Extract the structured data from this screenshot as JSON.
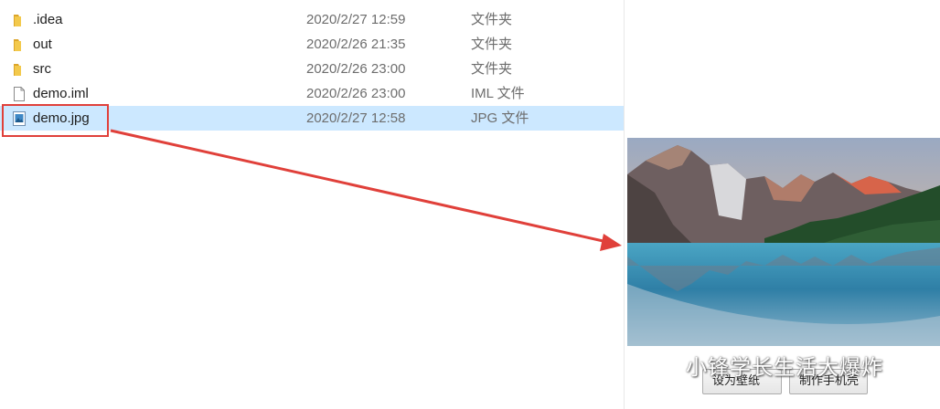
{
  "files": [
    {
      "icon": "folder-icon",
      "name": ".idea",
      "date": "2020/2/27 12:59",
      "type": "文件夹",
      "selected": false
    },
    {
      "icon": "folder-icon",
      "name": "out",
      "date": "2020/2/26 21:35",
      "type": "文件夹",
      "selected": false
    },
    {
      "icon": "folder-icon",
      "name": "src",
      "date": "2020/2/26 23:00",
      "type": "文件夹",
      "selected": false
    },
    {
      "icon": "file-icon",
      "name": "demo.iml",
      "date": "2020/2/26 23:00",
      "type": "IML 文件",
      "selected": false
    },
    {
      "icon": "image-file-icon",
      "name": "demo.jpg",
      "date": "2020/2/27 12:58",
      "type": "JPG 文件",
      "selected": true
    }
  ],
  "preview": {
    "buttons": {
      "wallpaper": "设为壁纸",
      "phone_case": "制作手机壳"
    }
  },
  "watermark": {
    "text": "小锋学长生活大爆炸"
  },
  "colors": {
    "selection": "#cce8ff",
    "annotation": "#e0403a",
    "folder": "#f3c94c"
  }
}
